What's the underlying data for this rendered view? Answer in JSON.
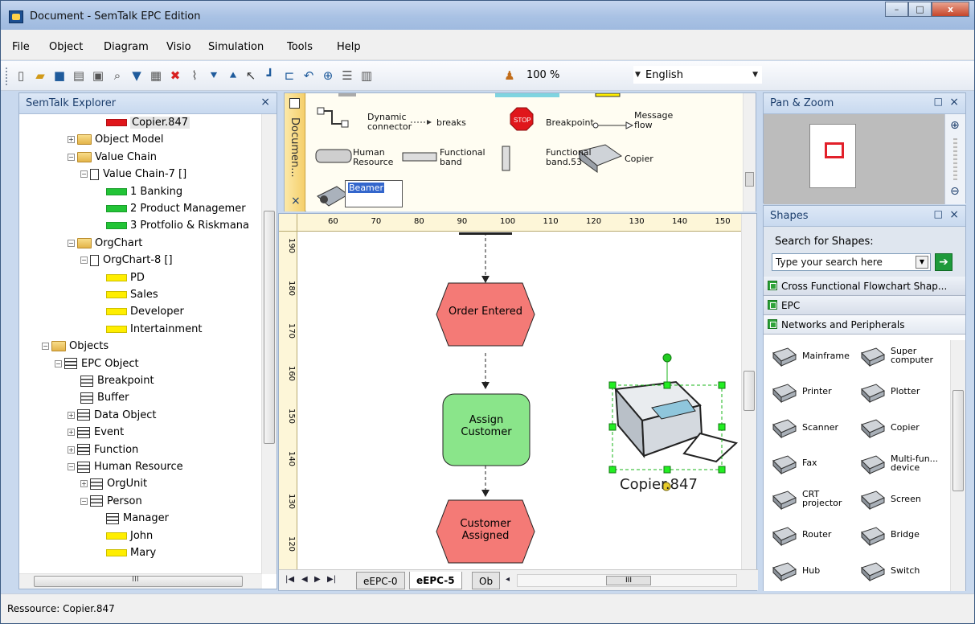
{
  "window": {
    "title": "Document - SemTalk EPC Edition",
    "minimize": "–",
    "maximize": "□",
    "close": "x"
  },
  "menu": [
    "File",
    "Object",
    "Diagram",
    "Visio",
    "Simulation",
    "Tools",
    "Help"
  ],
  "toolbar": {
    "zoom": "100 %",
    "language": "English",
    "icons": [
      "new-icon",
      "open-icon",
      "save-icon",
      "print-icon",
      "preview-icon",
      "find-icon",
      "filter-icon",
      "properties-icon",
      "delete-icon",
      "attach-icon",
      "down-icon",
      "up-icon",
      "pointer-icon",
      "connector-icon",
      "layout-icon",
      "undo-icon",
      "zoom-icon",
      "list-icon",
      "panel-icon",
      "users-icon"
    ]
  },
  "explorer": {
    "title": "SemTalk Explorer",
    "close": "×",
    "tree": [
      {
        "label": "Copier.847",
        "indent": 6,
        "kind": "swatch",
        "color": "#e0161b",
        "selected": true
      },
      {
        "label": "Object Model",
        "indent": 3,
        "kind": "folder",
        "pm": "+"
      },
      {
        "label": "Value Chain",
        "indent": 3,
        "kind": "folder",
        "pm": "−"
      },
      {
        "label": "Value Chain-7 []",
        "indent": 4,
        "kind": "doc",
        "pm": "−"
      },
      {
        "label": "1 Banking",
        "indent": 6,
        "kind": "swatch",
        "color": "#22c436"
      },
      {
        "label": "2 Product Managemer",
        "indent": 6,
        "kind": "swatch",
        "color": "#22c436"
      },
      {
        "label": "3 Protfolio & Riskmana",
        "indent": 6,
        "kind": "swatch",
        "color": "#22c436"
      },
      {
        "label": "OrgChart",
        "indent": 3,
        "kind": "folder",
        "pm": "−"
      },
      {
        "label": "OrgChart-8 []",
        "indent": 4,
        "kind": "doc",
        "pm": "−"
      },
      {
        "label": "PD",
        "indent": 6,
        "kind": "swatch",
        "color": "#ffee00"
      },
      {
        "label": "Sales",
        "indent": 6,
        "kind": "swatch",
        "color": "#ffee00"
      },
      {
        "label": "Developer",
        "indent": 6,
        "kind": "swatch",
        "color": "#ffee00"
      },
      {
        "label": "Intertainment",
        "indent": 6,
        "kind": "swatch",
        "color": "#ffee00"
      },
      {
        "label": "Objects",
        "indent": 1,
        "kind": "folder",
        "pm": "−"
      },
      {
        "label": "EPC Object",
        "indent": 2,
        "kind": "obj",
        "pm": "−"
      },
      {
        "label": "Breakpoint",
        "indent": 4,
        "kind": "obj"
      },
      {
        "label": "Buffer",
        "indent": 4,
        "kind": "obj"
      },
      {
        "label": "Data Object",
        "indent": 3,
        "kind": "obj",
        "pm": "+"
      },
      {
        "label": "Event",
        "indent": 3,
        "kind": "obj",
        "pm": "+"
      },
      {
        "label": "Function",
        "indent": 3,
        "kind": "obj",
        "pm": "+"
      },
      {
        "label": "Human Resource",
        "indent": 3,
        "kind": "obj",
        "pm": "−"
      },
      {
        "label": "OrgUnit",
        "indent": 4,
        "kind": "obj",
        "pm": "+"
      },
      {
        "label": "Person",
        "indent": 4,
        "kind": "obj",
        "pm": "−"
      },
      {
        "label": "Manager",
        "indent": 6,
        "kind": "obj"
      },
      {
        "label": "John",
        "indent": 6,
        "kind": "swatch",
        "color": "#ffee00"
      },
      {
        "label": "Mary",
        "indent": 6,
        "kind": "swatch",
        "color": "#ffee00"
      }
    ],
    "hscroll_label": "III"
  },
  "stencil": {
    "tab_label": "Documen...",
    "close": "×",
    "shapes": {
      "dynamic_connector": "Dynamic\nconnector",
      "breaks": "breaks",
      "breakpoint": "Breakpoint",
      "message_flow": "Message\nflow",
      "human_resource": "Human\nResource",
      "functional_band": "Functional\nband",
      "functional_band_53": "Functional\nband.53",
      "copier": "Copier",
      "beamer": "Beamer",
      "stop": "STOP"
    }
  },
  "canvas": {
    "hruler": [
      "60",
      "70",
      "80",
      "90",
      "100",
      "110",
      "120",
      "130",
      "140",
      "150"
    ],
    "vruler": [
      "190",
      "180",
      "170",
      "160",
      "150",
      "140",
      "130",
      "120"
    ],
    "shapes": [
      {
        "label": "Order Entered",
        "kind": "event",
        "color": "#f47a76"
      },
      {
        "label": "Assign\nCustomer",
        "kind": "function",
        "color": "#8ae58a"
      },
      {
        "label": "Customer\nAssigned",
        "kind": "event",
        "color": "#f47a76"
      }
    ],
    "selected_label": "Copier.847",
    "tabs": [
      "eEPC-0",
      "eEPC-5",
      "Ob"
    ],
    "active_tab": "eEPC-5",
    "hscroll_label": "III"
  },
  "panzoom": {
    "title": "Pan & Zoom",
    "max": "□",
    "close": "×"
  },
  "shapes_panel": {
    "title": "Shapes",
    "max": "□",
    "close": "×",
    "search_label": "Search for Shapes:",
    "search_placeholder": "Type your search here",
    "stencils": [
      "Cross Functional Flowchart Shap...",
      "EPC",
      "Networks and Peripherals"
    ],
    "items": [
      {
        "label": "Mainframe",
        "icon": "mainframe-icon"
      },
      {
        "label": "Super\ncomputer",
        "icon": "supercomputer-icon"
      },
      {
        "label": "Printer",
        "icon": "printer-icon"
      },
      {
        "label": "Plotter",
        "icon": "plotter-icon"
      },
      {
        "label": "Scanner",
        "icon": "scanner-icon"
      },
      {
        "label": "Copier",
        "icon": "copier-icon"
      },
      {
        "label": "Fax",
        "icon": "fax-icon"
      },
      {
        "label": "Multi-fun...\ndevice",
        "icon": "multifunction-icon"
      },
      {
        "label": "CRT\nprojector",
        "icon": "projector-icon"
      },
      {
        "label": "Screen",
        "icon": "screen-icon"
      },
      {
        "label": "Router",
        "icon": "router-icon"
      },
      {
        "label": "Bridge",
        "icon": "bridge-icon"
      },
      {
        "label": "Hub",
        "icon": "hub-icon"
      },
      {
        "label": "Switch",
        "icon": "switch-icon"
      }
    ]
  },
  "status": {
    "text": "Ressource: Copier.847"
  }
}
